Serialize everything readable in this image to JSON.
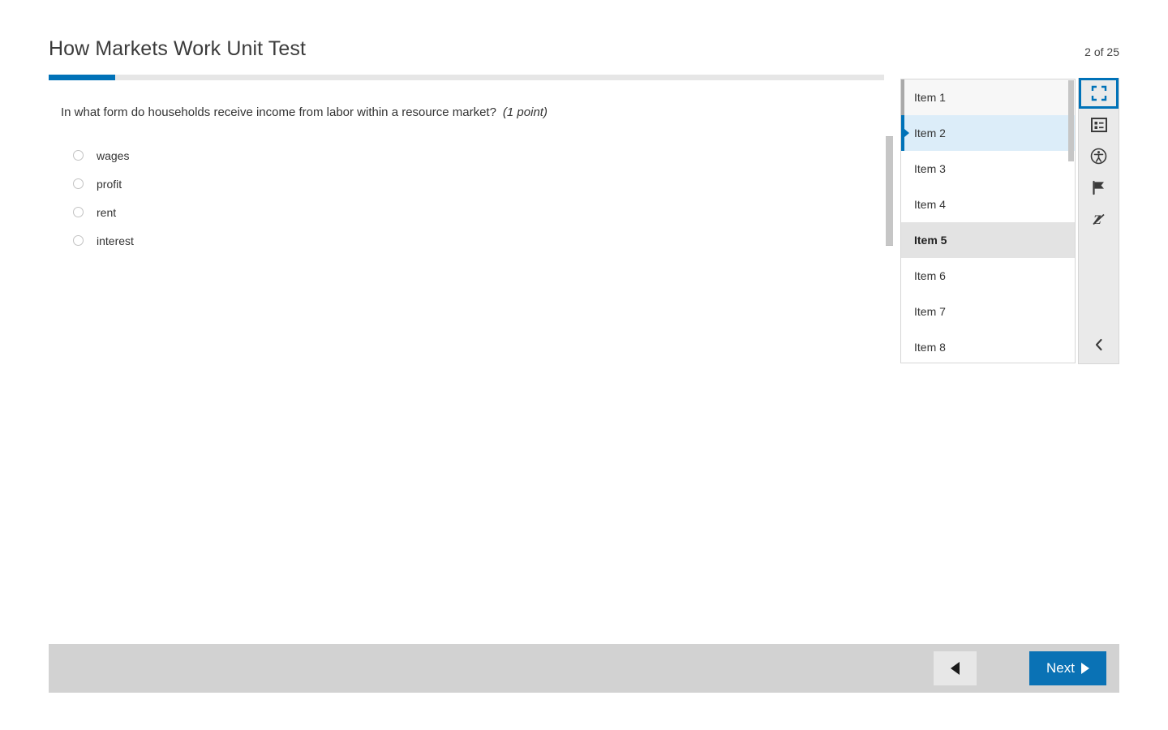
{
  "header": {
    "title": "How Markets Work Unit Test",
    "counter": "2 of 25"
  },
  "progress": {
    "percent": 8,
    "fill_color": "#0072b8",
    "track_color": "#e6e6e6"
  },
  "question": {
    "text": "In what form do households receive income from labor within a resource market?",
    "points": "(1 point)",
    "options": [
      {
        "label": "wages",
        "selected": false
      },
      {
        "label": "profit",
        "selected": false
      },
      {
        "label": "rent",
        "selected": false
      },
      {
        "label": "interest",
        "selected": false
      }
    ]
  },
  "item_list": {
    "items": [
      {
        "label": "Item 1",
        "state": "faint"
      },
      {
        "label": "Item 2",
        "state": "active"
      },
      {
        "label": "Item 3",
        "state": "normal"
      },
      {
        "label": "Item 4",
        "state": "normal"
      },
      {
        "label": "Item 5",
        "state": "hover"
      },
      {
        "label": "Item 6",
        "state": "normal"
      },
      {
        "label": "Item 7",
        "state": "normal"
      },
      {
        "label": "Item 8",
        "state": "normal"
      }
    ]
  },
  "tools": {
    "accent_color": "#0072b8",
    "buttons": [
      {
        "icon": "fullscreen-icon",
        "active": true
      },
      {
        "icon": "item-review-list-icon",
        "active": false
      },
      {
        "icon": "accessibility-icon",
        "active": false
      },
      {
        "icon": "flag-icon",
        "active": false
      },
      {
        "icon": "zoom-off-icon",
        "active": false
      }
    ],
    "collapse_icon": "chevron-left-icon"
  },
  "footer": {
    "previous_label": "",
    "previous_icon": "triangle-left-icon",
    "next_label": "Next",
    "next_icon": "triangle-right-icon",
    "next_color": "#0a72b5"
  }
}
